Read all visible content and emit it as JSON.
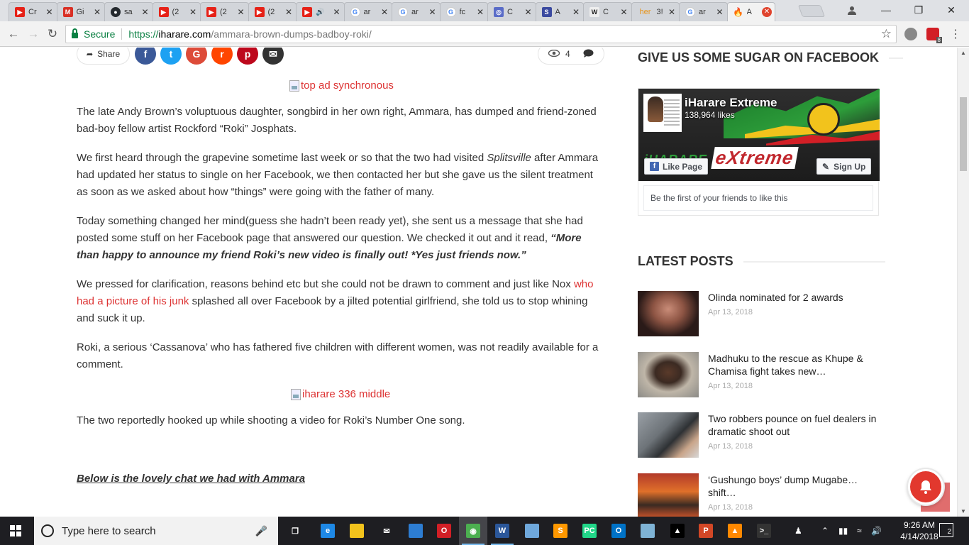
{
  "browser": {
    "tabs": [
      {
        "label": "Cr",
        "icon": "youtube-icon",
        "color": "#e62117"
      },
      {
        "label": "Gi",
        "icon": "gmail-icon",
        "color": "#d93025"
      },
      {
        "label": "sa",
        "icon": "github-icon",
        "color": "#24292e"
      },
      {
        "label": "(2",
        "icon": "youtube-icon",
        "color": "#e62117"
      },
      {
        "label": "(2",
        "icon": "youtube-icon",
        "color": "#e62117"
      },
      {
        "label": "(2",
        "icon": "youtube-icon",
        "color": "#e62117"
      },
      {
        "label": "",
        "icon": "youtube-audio-icon",
        "color": "#e62117"
      },
      {
        "label": "ar",
        "icon": "google-icon",
        "color": "#4285f4"
      },
      {
        "label": "ar",
        "icon": "google-icon",
        "color": "#4285f4"
      },
      {
        "label": "fc",
        "icon": "google-icon",
        "color": "#4285f4"
      },
      {
        "label": "C",
        "icon": "blue-ring-icon",
        "color": "#5a6cc8"
      },
      {
        "label": "A",
        "icon": "s-icon",
        "color": "#3b4aa0"
      },
      {
        "label": "C",
        "icon": "wikipedia-icon",
        "color": "#eeeeee"
      },
      {
        "label": "3!",
        "icon": "her-icon",
        "color": "#ffffff"
      },
      {
        "label": "ar",
        "icon": "google-icon",
        "color": "#4285f4"
      },
      {
        "label": "A",
        "icon": "fire-icon",
        "color": "#ff6a00",
        "active": true
      }
    ],
    "her_tab_text": "her",
    "url": {
      "scheme": "https://",
      "host": "iharare.com",
      "path": "/ammara-brown-dumps-badboy-roki/"
    },
    "secure_label": "Secure",
    "extension_badge": "8"
  },
  "share": {
    "label": "Share",
    "views": "4",
    "networks": [
      {
        "name": "facebook",
        "glyph": "f",
        "color": "#3b5998"
      },
      {
        "name": "twitter",
        "glyph": "t",
        "color": "#1da1f2"
      },
      {
        "name": "google-plus",
        "glyph": "G",
        "color": "#dd4b39"
      },
      {
        "name": "reddit",
        "glyph": "r",
        "color": "#ff4500"
      },
      {
        "name": "pinterest",
        "glyph": "p",
        "color": "#bd081c"
      },
      {
        "name": "email",
        "glyph": "✉",
        "color": "#333333"
      }
    ]
  },
  "ads": {
    "top": "top ad synchronous",
    "middle": "iharare 336 middle"
  },
  "article": {
    "p1": "The late Andy Brown’s voluptuous daughter, songbird in her own right, Ammara, has dumped and friend-zoned bad-boy fellow artist Rockford “Roki” Josphats.",
    "p2_a": "We first heard through the grapevine sometime last week or so that the two had visited ",
    "p2_em": "Splitsville",
    "p2_b": " after Ammara had updated her status to single on her Facebook, we then contacted her but she gave us the silent treatment as soon as we asked about how “things” were going with the father of many.",
    "p3_a": "Today something changed her mind(guess she hadn’t been ready yet), she sent us a message that she had posted some stuff on her Facebook page that answered our question. We checked it out and it read, ",
    "p3_quote": "“More than happy to announce my friend Roki’s new video is finally out! *Yes just friends now.”",
    "p4_a": "We pressed for clarification, reasons behind etc but she could not be drawn to comment and just like Nox ",
    "p4_link": "who had a picture of his junk",
    "p4_b": " splashed all over Facebook by a jilted potential girlfriend, she told us to stop whining and suck it up.",
    "p5": "Roki, a serious ‘Cassanova’ who has fathered five children with different women, was not readily available for a comment.",
    "p6": "The two reportedly hooked up while shooting a video for Roki’s Number One song.",
    "p7": "Below is the lovely chat we had with Ammara"
  },
  "sidebar": {
    "fb_heading": "GIVE US SOME SUGAR ON FACEBOOK",
    "fb": {
      "page_name": "iHarare Extreme",
      "likes": "138,964 likes",
      "like_button": "Like Page",
      "signup_button": "Sign Up",
      "footer": "Be the first of your friends to like this",
      "cover_brand_prefix": "iHARARE",
      "cover_brand": "eXtreme"
    },
    "latest_heading": "LATEST POSTS",
    "posts": [
      {
        "title": "Olinda nominated for 2 awards",
        "date": "Apr 13, 2018"
      },
      {
        "title": "Madhuku to the rescue as Khupe & Chamisa fight takes new…",
        "date": "Apr 13, 2018"
      },
      {
        "title": "Two robbers pounce on fuel dealers in dramatic shoot out",
        "date": "Apr 13, 2018"
      },
      {
        "title": "‘Gushungo boys’ dump Mugabe… shift…",
        "date": "Apr 13, 2018"
      }
    ]
  },
  "taskbar": {
    "search_placeholder": "Type here to search",
    "time": "9:26 AM",
    "date": "4/14/2018",
    "notifications": "2"
  },
  "colors": {
    "accent_red": "#dd3333",
    "chrome_secure": "#0b8043",
    "facebook_blue": "#4267b2"
  }
}
